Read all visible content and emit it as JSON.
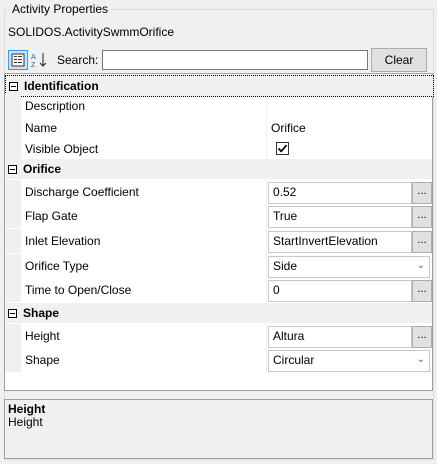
{
  "panel": {
    "title": "Activity Properties",
    "object_name": "SOLIDOS.ActivitySwmmOrifice"
  },
  "toolbar": {
    "categorized_icon": "categorized-view-icon",
    "alphabetical_icon": "alphabetical-sort-icon",
    "search_label": "Search:",
    "search_value": "",
    "clear_label": "Clear"
  },
  "categories": {
    "identification": {
      "label": "Identification",
      "rows": [
        {
          "name": "Description",
          "value": ""
        },
        {
          "name": "Name",
          "value": "Orifice"
        },
        {
          "name": "Visible Object",
          "value": "checked"
        }
      ]
    },
    "orifice": {
      "label": "Orifice",
      "rows": [
        {
          "name": "Discharge Coefficient",
          "value": "0.52"
        },
        {
          "name": "Flap Gate",
          "value": "True"
        },
        {
          "name": "Inlet Elevation",
          "value": "StartInvertElevation"
        },
        {
          "name": "Orifice Type",
          "value": "Side"
        },
        {
          "name": "Time to Open/Close",
          "value": "0"
        }
      ]
    },
    "shape": {
      "label": "Shape",
      "rows": [
        {
          "name": "Height",
          "value": "Altura"
        },
        {
          "name": "Shape",
          "value": "Circular"
        }
      ]
    }
  },
  "buttons": {
    "ellipsis": "..."
  },
  "help": {
    "title": "Height",
    "text": "Height"
  }
}
